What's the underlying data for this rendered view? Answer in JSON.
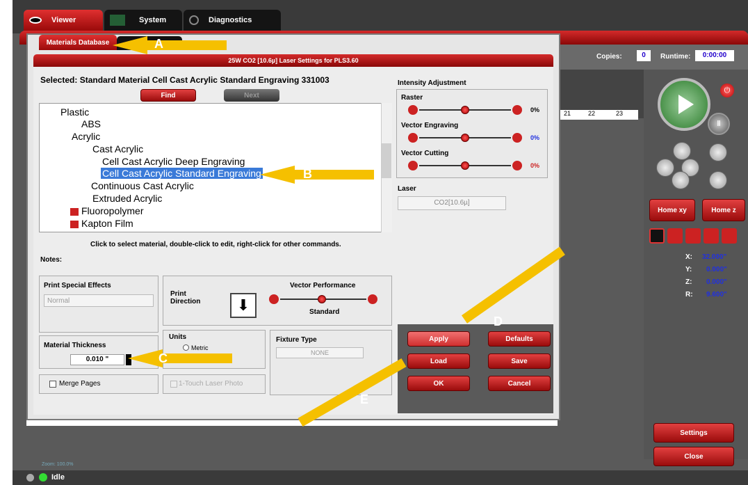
{
  "tabs": {
    "viewer": "Viewer",
    "system": "System",
    "diagnostics": "Diagnostics"
  },
  "header": {
    "copies_label": "Copies:",
    "copies_value": "0",
    "runtime_label": "Runtime:",
    "runtime_value": "0:00:00"
  },
  "ruler": {
    "ticks": [
      "21",
      "22",
      "23"
    ]
  },
  "dialog": {
    "tab": "Materials Database",
    "title": "25W CO2 [10.6µ] Laser Settings for PLS3.60",
    "selected": "Selected: Standard Material Cell Cast Acrylic Standard Engraving 331003",
    "find": "Find",
    "next": "Next",
    "tree": [
      "Plastic",
      "ABS",
      "Acrylic",
      "Cast Acrylic",
      "Cell Cast Acrylic Deep Engraving",
      "Cell Cast Acrylic Standard Engraving",
      "Continuous Cast Acrylic",
      "Extruded Acrylic",
      "Fluoropolymer",
      "Kapton Film"
    ],
    "hint": "Click to select material, double-click to edit, right-click for other commands.",
    "notes": "Notes:",
    "pse_label": "Print Special Effects",
    "pse_value": "Normal",
    "print_dir": "Print\nDirection",
    "vector_perf": "Vector Performance",
    "vector_perf_value": "Standard",
    "thickness_label": "Material Thickness",
    "thickness_value": "0.010 \"",
    "units_label": "Units",
    "metric": "Metric",
    "fixture_label": "Fixture Type",
    "fixture_value": "NONE",
    "merge": "Merge Pages",
    "photo": "1-Touch Laser Photo",
    "intensity": "Intensity Adjustment",
    "raster": "Raster",
    "raster_pct": "0%",
    "vengrave": "Vector Engraving",
    "vengrave_pct": "0%",
    "vcut": "Vector Cutting",
    "vcut_pct": "0%",
    "laser": "Laser",
    "laser_value": "CO2[10.6µ]",
    "apply": "Apply",
    "defaults": "Defaults",
    "load": "Load",
    "save": "Save",
    "ok": "OK",
    "cancel": "Cancel"
  },
  "controls": {
    "home_xy": "Home xy",
    "home_z": "Home z",
    "settings": "Settings",
    "close": "Close",
    "x_label": "X:",
    "x": "32.000\"",
    "y_label": "Y:",
    "y": "0.000\"",
    "z_label": "Z:",
    "z": "0.000\"",
    "r_label": "R:",
    "r": "9.600\""
  },
  "status": {
    "text": "Idle",
    "zoom": "Zoom: 100.0%"
  },
  "callouts": [
    "A",
    "B",
    "C",
    "D",
    "E"
  ],
  "colors": {
    "accent_red": "#c81e1e",
    "selection": "#3a7ad8",
    "callout": "#f5c000"
  }
}
